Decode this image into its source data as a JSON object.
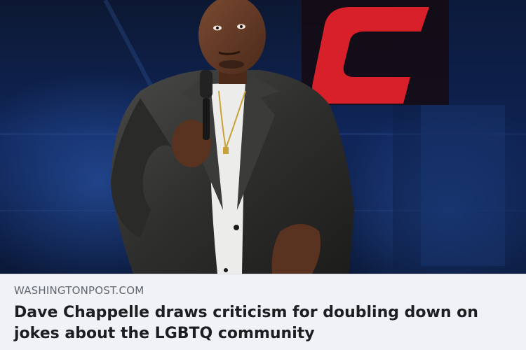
{
  "link_preview": {
    "domain": "WASHINGTONPOST.COM",
    "headline": "Dave Chappelle draws criticism for doubling down on jokes about the LGBTQ community",
    "image": {
      "icon": "photo-comedian-on-stage"
    }
  },
  "colors": {
    "background": "#f0f2f5",
    "domain_text": "#606770",
    "headline_text": "#1c1e21",
    "stage_backdrop": "#0d1e44",
    "sign_red": "#d8202a"
  }
}
